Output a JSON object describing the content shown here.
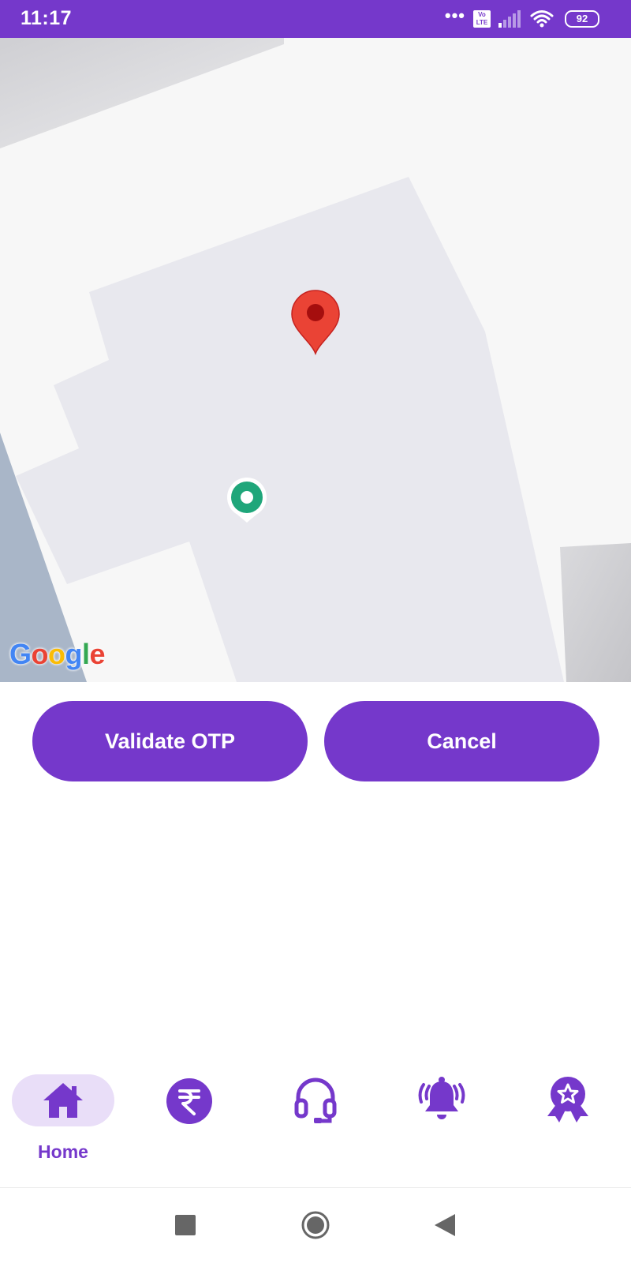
{
  "status_bar": {
    "time": "11:17",
    "volte_top": "Vo",
    "volte_bottom": "LTE",
    "battery": "92",
    "icons": [
      "more-dots-icon",
      "volte-icon",
      "signal-icon",
      "wifi-icon",
      "battery-icon"
    ]
  },
  "map": {
    "logo_letters": [
      "G",
      "o",
      "o",
      "g",
      "l",
      "e"
    ],
    "markers": [
      "destination-pin-icon",
      "current-location-icon"
    ]
  },
  "actions": {
    "validate_label": "Validate OTP",
    "cancel_label": "Cancel"
  },
  "bottom_nav": {
    "items": [
      {
        "label": "Home",
        "icon": "home-icon",
        "active": true
      },
      {
        "label": "",
        "icon": "rupee-icon",
        "active": false
      },
      {
        "label": "",
        "icon": "headset-icon",
        "active": false
      },
      {
        "label": "",
        "icon": "bell-ringing-icon",
        "active": false
      },
      {
        "label": "",
        "icon": "award-badge-icon",
        "active": false
      }
    ]
  },
  "system_nav": {
    "icons": [
      "recents-square-icon",
      "home-circle-icon",
      "back-triangle-icon"
    ]
  },
  "colors": {
    "primary": "#7538cb",
    "primary_light": "#e9def8",
    "pin_red": "#ea4335",
    "location_green": "#1fa67a",
    "map_building": "#e8e8ee",
    "map_background": "#f7f7f7"
  }
}
